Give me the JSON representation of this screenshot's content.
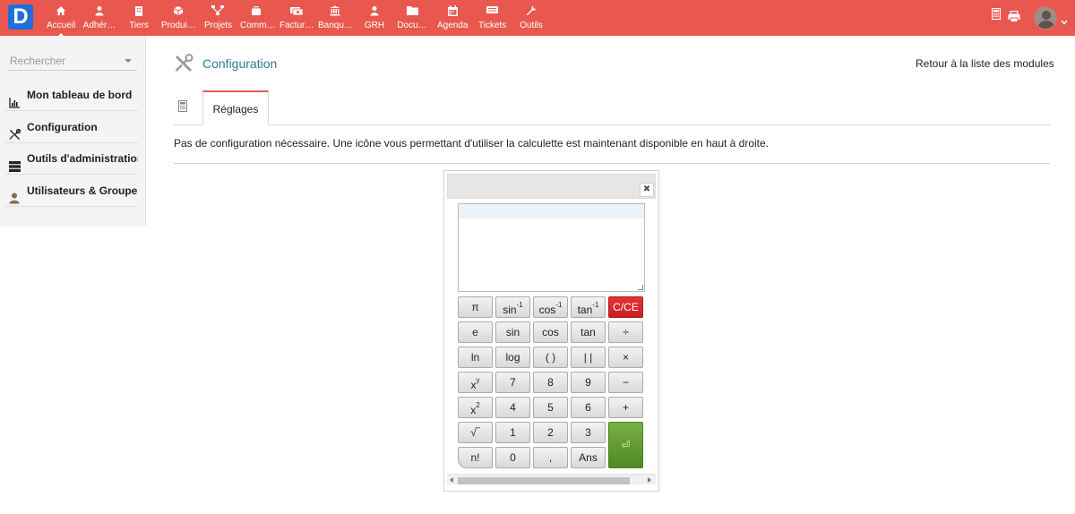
{
  "brand": {
    "logo_letter": "D",
    "color": "#1e6fd9"
  },
  "topbar": {
    "color": "#e9584e",
    "nav": [
      {
        "label": "Accueil",
        "icon": "home-icon",
        "active": true
      },
      {
        "label": "Adhér…",
        "icon": "user-icon"
      },
      {
        "label": "Tiers",
        "icon": "building-icon"
      },
      {
        "label": "Produi…",
        "icon": "cube-icon"
      },
      {
        "label": "Projets",
        "icon": "sitemap-icon"
      },
      {
        "label": "Comm…",
        "icon": "briefcase-icon"
      },
      {
        "label": "Factur…",
        "icon": "money-icon"
      },
      {
        "label": "Banqu…",
        "icon": "bank-icon"
      },
      {
        "label": "GRH",
        "icon": "person-icon"
      },
      {
        "label": "Docu…",
        "icon": "folder-icon"
      },
      {
        "label": "Agenda",
        "icon": "calendar-icon"
      },
      {
        "label": "Tickets",
        "icon": "ticket-icon"
      },
      {
        "label": "Outils",
        "icon": "wrench-icon"
      }
    ],
    "right_icons": [
      "calculator-icon",
      "print-icon",
      "avatar",
      "chevron-down-icon"
    ]
  },
  "sidebar": {
    "search_placeholder": "Rechercher",
    "items": [
      {
        "label": "Mon tableau de bord",
        "icon": "chart-icon"
      },
      {
        "label": "Configuration",
        "icon": "tools-icon"
      },
      {
        "label": "Outils d'administration",
        "icon": "server-icon"
      },
      {
        "label": "Utilisateurs & Groupes",
        "icon": "user-icon"
      }
    ]
  },
  "main": {
    "title": "Configuration",
    "back_link": "Retour à la liste des modules",
    "tab_label": "Réglages",
    "description": "Pas de configuration nécessaire. Une icône vous permettant d'utiliser la calculette est maintenant disponible en haut à droite."
  },
  "calculator": {
    "close_icon": "✖",
    "keys": {
      "pi": "π",
      "asin": "sin",
      "acos": "cos",
      "atan": "tan",
      "inv_exp": "-1",
      "clear": "C/CE",
      "e": "e",
      "sin": "sin",
      "cos": "cos",
      "tan": "tan",
      "div": "÷",
      "ln": "ln",
      "log": "log",
      "paren": "( )",
      "abs": "| |",
      "mul": "×",
      "xy_base": "x",
      "xy_exp": "y",
      "k7": "7",
      "k8": "8",
      "k9": "9",
      "minus": "−",
      "x2_base": "x",
      "x2_exp": "2",
      "k4": "4",
      "k5": "5",
      "k6": "6",
      "plus": "+",
      "sqrt": "√‾",
      "k1": "1",
      "k2": "2",
      "k3": "3",
      "enter": "⏎",
      "fact": "n!",
      "k0": "0",
      "dot": ",",
      "ans": "Ans"
    },
    "colors": {
      "clear": "#d2232a",
      "enter": "#5f9a2e"
    }
  }
}
